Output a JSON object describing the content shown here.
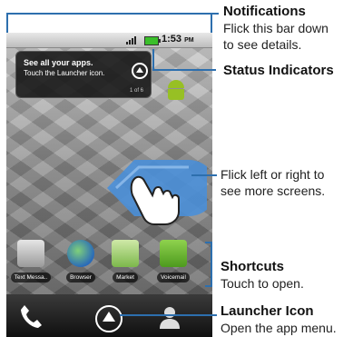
{
  "status": {
    "time": "1:53",
    "ampm": "PM"
  },
  "popup": {
    "title": "See all your apps.",
    "subtitle": "Touch the Launcher icon.",
    "page": "1 of 6"
  },
  "apps": [
    {
      "label": "Text Messa..",
      "icon": "envelope-icon"
    },
    {
      "label": "Browser",
      "icon": "globe-icon"
    },
    {
      "label": "Market",
      "icon": "shopping-bag-icon"
    },
    {
      "label": "Voicemail",
      "icon": "voicemail-icon"
    }
  ],
  "callouts": {
    "notifications": {
      "title": "Notifications",
      "line1": "Flick this bar down",
      "line2": "to see details."
    },
    "status": {
      "title": "Status Indicators"
    },
    "flick": {
      "line1": "Flick left or right to",
      "line2": "see more screens."
    },
    "shortcuts": {
      "title": "Shortcuts",
      "line1": "Touch to open."
    },
    "launcher": {
      "title": "Launcher Icon",
      "line1": "Open the app menu."
    }
  },
  "colors": {
    "accent": "#2d6fae",
    "arrow": "#4a8fd8",
    "android": "#97c024"
  }
}
